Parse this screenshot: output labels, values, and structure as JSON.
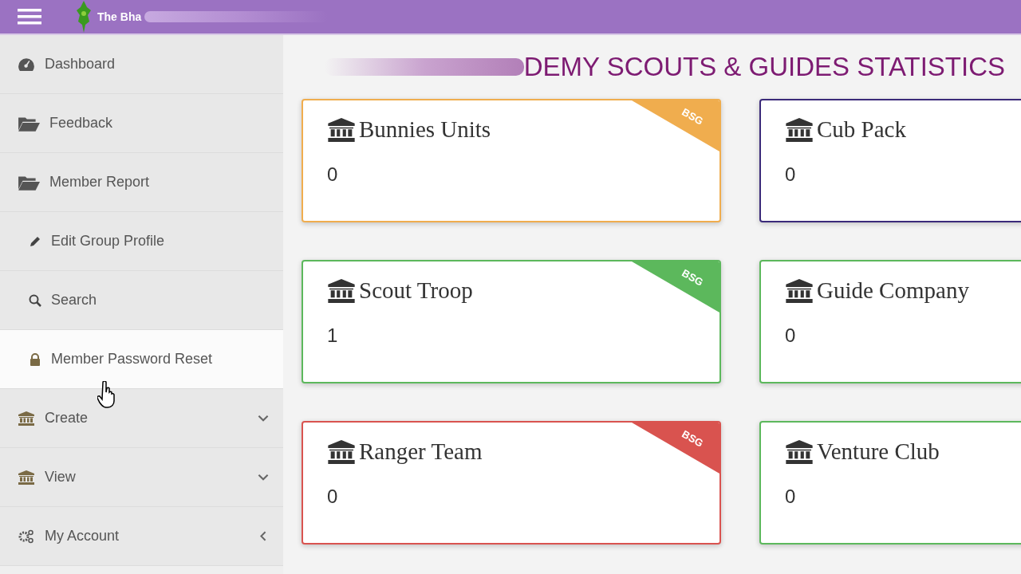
{
  "header": {
    "title": "The Bha"
  },
  "page_title": "DEMY SCOUTS & GUIDES STATISTICS",
  "sidebar": {
    "items": [
      {
        "label": "Dashboard",
        "selected": false,
        "kind": "link"
      },
      {
        "label": "Feedback",
        "selected": false,
        "kind": "link"
      },
      {
        "label": "Member Report",
        "selected": false,
        "kind": "link"
      },
      {
        "label": "Edit Group Profile",
        "selected": false,
        "kind": "link"
      },
      {
        "label": "Search",
        "selected": false,
        "kind": "link"
      },
      {
        "label": "Member Password Reset",
        "selected": true,
        "kind": "link"
      },
      {
        "label": "Create",
        "selected": false,
        "kind": "dropdown"
      },
      {
        "label": "View",
        "selected": false,
        "kind": "dropdown"
      },
      {
        "label": "My Account",
        "selected": false,
        "kind": "submenu"
      }
    ]
  },
  "cards": [
    {
      "title": "Bunnies Units",
      "value": "0",
      "color": "#f0ad4e",
      "ribbon": "BSG"
    },
    {
      "title": "Cub Pack",
      "value": "0",
      "color": "#3b2a7a"
    },
    {
      "title": "Scout Troop",
      "value": "1",
      "color": "#5cb85c",
      "ribbon": "BSG"
    },
    {
      "title": "Guide Company",
      "value": "0",
      "color": "#5cb85c"
    },
    {
      "title": "Ranger Team",
      "value": "0",
      "color": "#d9534f",
      "ribbon": "BSG"
    },
    {
      "title": "Venture Club",
      "value": "0",
      "color": "#5cb85c"
    }
  ]
}
